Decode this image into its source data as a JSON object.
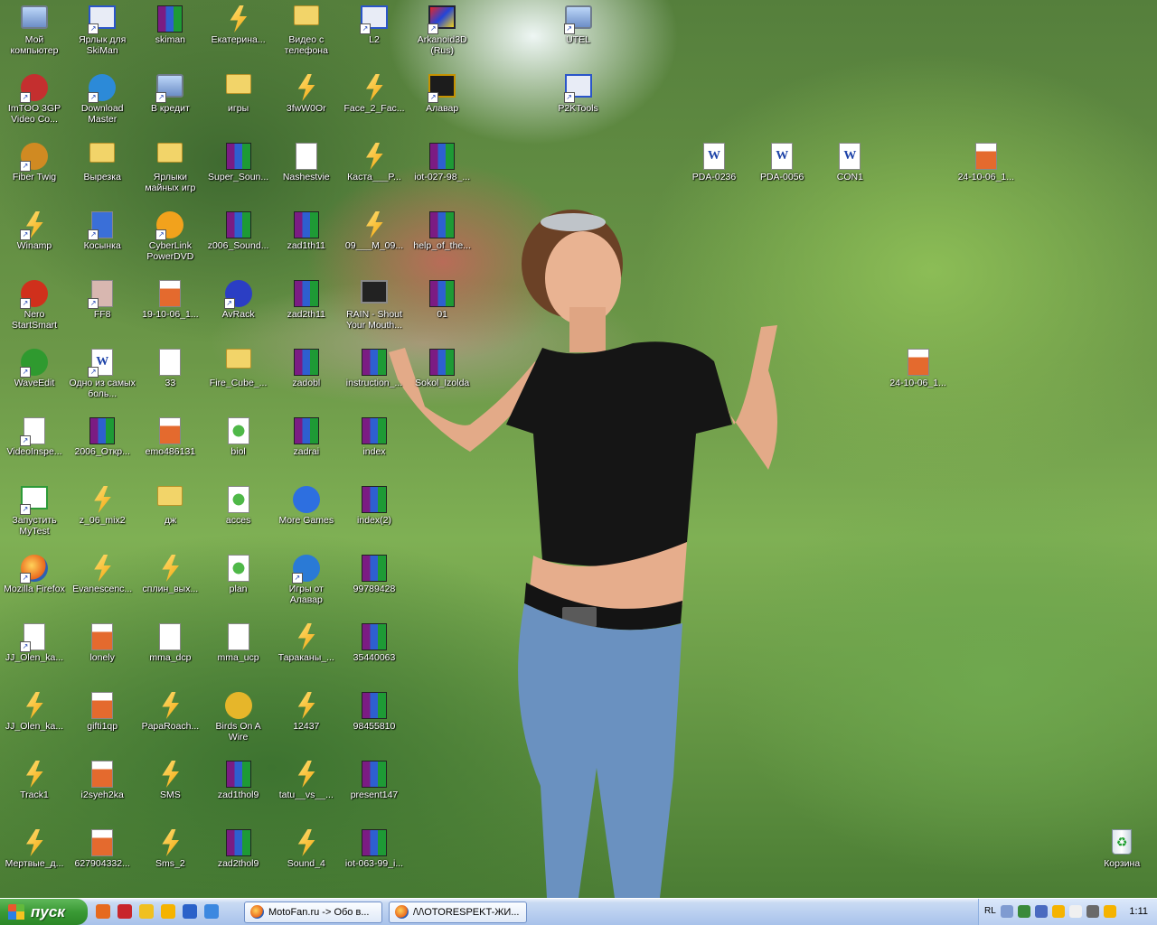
{
  "desktop": {
    "icons": [
      {
        "label": "Мой компьютер",
        "col": 0,
        "row": 0,
        "type": "pc",
        "shortcut": false
      },
      {
        "label": "Ярлык для SkiMan",
        "col": 1,
        "row": 0,
        "type": "app",
        "shortcut": true
      },
      {
        "label": "skiman",
        "col": 2,
        "row": 0,
        "type": "rar",
        "shortcut": false
      },
      {
        "label": "Екатерина...",
        "col": 3,
        "row": 0,
        "type": "winamp",
        "shortcut": false
      },
      {
        "label": "Видео с телефона",
        "col": 4,
        "row": 0,
        "type": "folder",
        "shortcut": false
      },
      {
        "label": "L2",
        "col": 5,
        "row": 0,
        "type": "app",
        "shortcut": true
      },
      {
        "label": "Arkanoid3D (Rus)",
        "col": 6,
        "row": 0,
        "type": "arkanoid",
        "shortcut": true
      },
      {
        "label": "UTEL",
        "col": 8,
        "row": 0,
        "type": "pc",
        "shortcut": true
      },
      {
        "label": "ImTOO 3GP Video Co...",
        "col": 0,
        "row": 1,
        "type": "imtoo",
        "shortcut": true
      },
      {
        "label": "Download Master",
        "col": 1,
        "row": 1,
        "type": "dlm",
        "shortcut": true
      },
      {
        "label": "В кредит",
        "col": 2,
        "row": 1,
        "type": "pc",
        "shortcut": true
      },
      {
        "label": "игры",
        "col": 3,
        "row": 1,
        "type": "folder",
        "shortcut": false
      },
      {
        "label": "3fwW0Or",
        "col": 4,
        "row": 1,
        "type": "winamp",
        "shortcut": false
      },
      {
        "label": "Face_2_Fac...",
        "col": 5,
        "row": 1,
        "type": "winamp",
        "shortcut": false
      },
      {
        "label": "Алавар",
        "col": 6,
        "row": 1,
        "type": "alawar",
        "shortcut": true
      },
      {
        "label": "P2KTools",
        "col": 8,
        "row": 1,
        "type": "app",
        "shortcut": true
      },
      {
        "label": "Fiber Twig",
        "col": 0,
        "row": 2,
        "type": "twig",
        "shortcut": true
      },
      {
        "label": "Вырезка",
        "col": 1,
        "row": 2,
        "type": "folder",
        "shortcut": false
      },
      {
        "label": "Ярлыки майных игр",
        "col": 2,
        "row": 2,
        "type": "folder",
        "shortcut": false
      },
      {
        "label": "Super_Soun...",
        "col": 3,
        "row": 2,
        "type": "rar",
        "shortcut": false
      },
      {
        "label": "Nashestvie",
        "col": 4,
        "row": 2,
        "type": "file",
        "shortcut": false
      },
      {
        "label": "Каста___P...",
        "col": 5,
        "row": 2,
        "type": "winamp",
        "shortcut": false
      },
      {
        "label": "iot-027-98_...",
        "col": 6,
        "row": 2,
        "type": "rar",
        "shortcut": false
      },
      {
        "label": "PDA-0236",
        "col": 10,
        "row": 2,
        "type": "word",
        "shortcut": false
      },
      {
        "label": "PDA-0056",
        "col": 11,
        "row": 2,
        "type": "word",
        "shortcut": false
      },
      {
        "label": "CON1",
        "col": 12,
        "row": 2,
        "type": "word",
        "shortcut": false
      },
      {
        "label": "24-10-06_1...",
        "col": 14,
        "row": 2,
        "type": "media",
        "shortcut": false
      },
      {
        "label": "Winamp",
        "col": 0,
        "row": 3,
        "type": "winamp",
        "shortcut": true
      },
      {
        "label": "Косынка",
        "col": 1,
        "row": 3,
        "type": "cards",
        "shortcut": true
      },
      {
        "label": "CyberLink PowerDVD",
        "col": 2,
        "row": 3,
        "type": "dvd",
        "shortcut": true
      },
      {
        "label": "z006_Sound...",
        "col": 3,
        "row": 3,
        "type": "rar",
        "shortcut": false
      },
      {
        "label": "zad1th11",
        "col": 4,
        "row": 3,
        "type": "rar",
        "shortcut": false
      },
      {
        "label": "09___M_09...",
        "col": 5,
        "row": 3,
        "type": "winamp",
        "shortcut": false
      },
      {
        "label": "help_of_the...",
        "col": 6,
        "row": 3,
        "type": "rar",
        "shortcut": false
      },
      {
        "label": "Nero StartSmart",
        "col": 0,
        "row": 4,
        "type": "nero",
        "shortcut": true
      },
      {
        "label": "FF8",
        "col": 1,
        "row": 4,
        "type": "ff8",
        "shortcut": true
      },
      {
        "label": "19-10-06_1...",
        "col": 2,
        "row": 4,
        "type": "media",
        "shortcut": false
      },
      {
        "label": "AvRack",
        "col": 3,
        "row": 4,
        "type": "avrack",
        "shortcut": true
      },
      {
        "label": "zad2th11",
        "col": 4,
        "row": 4,
        "type": "rar",
        "shortcut": false
      },
      {
        "label": "RAIN - Shout Your Mouth...",
        "col": 5,
        "row": 4,
        "type": "clapper",
        "shortcut": false
      },
      {
        "label": "01",
        "col": 6,
        "row": 4,
        "type": "rar",
        "shortcut": false
      },
      {
        "label": "WaveEdit",
        "col": 0,
        "row": 5,
        "type": "wave",
        "shortcut": true
      },
      {
        "label": "Одно из самых боль...",
        "col": 1,
        "row": 5,
        "type": "word",
        "shortcut": true
      },
      {
        "label": "33",
        "col": 2,
        "row": 5,
        "type": "file",
        "shortcut": false
      },
      {
        "label": "Fire_Cube_...",
        "col": 3,
        "row": 5,
        "type": "folder",
        "shortcut": false
      },
      {
        "label": "zadobl",
        "col": 4,
        "row": 5,
        "type": "rar",
        "shortcut": false
      },
      {
        "label": "instruction_...",
        "col": 5,
        "row": 5,
        "type": "rar",
        "shortcut": false
      },
      {
        "label": "Sokol_Izolda",
        "col": 6,
        "row": 5,
        "type": "rar",
        "shortcut": false
      },
      {
        "label": "24-10-06_1...",
        "col": 13,
        "row": 5,
        "type": "media",
        "shortcut": false
      },
      {
        "label": "VideoInspe...",
        "col": 0,
        "row": 6,
        "type": "file",
        "shortcut": true
      },
      {
        "label": "2006_Откр...",
        "col": 1,
        "row": 6,
        "type": "rar",
        "shortcut": false
      },
      {
        "label": "emo486131",
        "col": 2,
        "row": 6,
        "type": "media",
        "shortcut": false
      },
      {
        "label": "biol",
        "col": 3,
        "row": 6,
        "type": "globe",
        "shortcut": false
      },
      {
        "label": "zadrai",
        "col": 4,
        "row": 6,
        "type": "rar",
        "shortcut": false
      },
      {
        "label": "index",
        "col": 5,
        "row": 6,
        "type": "rar",
        "shortcut": false
      },
      {
        "label": "Запустить MyTest",
        "col": 0,
        "row": 7,
        "type": "mytest",
        "shortcut": true
      },
      {
        "label": "z_06_mix2",
        "col": 1,
        "row": 7,
        "type": "winamp",
        "shortcut": false
      },
      {
        "label": "дж",
        "col": 2,
        "row": 7,
        "type": "folder",
        "shortcut": false
      },
      {
        "label": "acces",
        "col": 3,
        "row": 7,
        "type": "globe",
        "shortcut": false
      },
      {
        "label": "More Games",
        "col": 4,
        "row": 7,
        "type": "moregames",
        "shortcut": false
      },
      {
        "label": "index(2)",
        "col": 5,
        "row": 7,
        "type": "rar",
        "shortcut": false
      },
      {
        "label": "Mozilla Firefox",
        "col": 0,
        "row": 8,
        "type": "firefox",
        "shortcut": true
      },
      {
        "label": "Evanescenc...",
        "col": 1,
        "row": 8,
        "type": "winamp",
        "shortcut": false
      },
      {
        "label": "сплин_вых...",
        "col": 2,
        "row": 8,
        "type": "winamp",
        "shortcut": false
      },
      {
        "label": "plan",
        "col": 3,
        "row": 8,
        "type": "globe",
        "shortcut": false
      },
      {
        "label": "Игры от Алавар",
        "col": 4,
        "row": 8,
        "type": "alawar2",
        "shortcut": true
      },
      {
        "label": "99789428",
        "col": 5,
        "row": 8,
        "type": "rar",
        "shortcut": false
      },
      {
        "label": "JJ_Olen_ka...",
        "col": 0,
        "row": 9,
        "type": "file",
        "shortcut": true
      },
      {
        "label": "lonely",
        "col": 1,
        "row": 9,
        "type": "media",
        "shortcut": false
      },
      {
        "label": "mma_dcp",
        "col": 2,
        "row": 9,
        "type": "file",
        "shortcut": false
      },
      {
        "label": "mma_ucp",
        "col": 3,
        "row": 9,
        "type": "file",
        "shortcut": false
      },
      {
        "label": "Тараканы_...",
        "col": 4,
        "row": 9,
        "type": "winamp",
        "shortcut": false
      },
      {
        "label": "35440063",
        "col": 5,
        "row": 9,
        "type": "rar",
        "shortcut": false
      },
      {
        "label": "JJ_Olen_ka...",
        "col": 0,
        "row": 10,
        "type": "winamp",
        "shortcut": false
      },
      {
        "label": "gifti1qp",
        "col": 1,
        "row": 10,
        "type": "media",
        "shortcut": false
      },
      {
        "label": "PapaRoach...",
        "col": 2,
        "row": 10,
        "type": "winamp",
        "shortcut": false
      },
      {
        "label": "Birds On A Wire",
        "col": 3,
        "row": 10,
        "type": "bird",
        "shortcut": false
      },
      {
        "label": "12437",
        "col": 4,
        "row": 10,
        "type": "winamp",
        "shortcut": false
      },
      {
        "label": "98455810",
        "col": 5,
        "row": 10,
        "type": "rar",
        "shortcut": false
      },
      {
        "label": "Track1",
        "col": 0,
        "row": 11,
        "type": "winamp",
        "shortcut": false
      },
      {
        "label": "i2syeh2ka",
        "col": 1,
        "row": 11,
        "type": "media",
        "shortcut": false
      },
      {
        "label": "SMS",
        "col": 2,
        "row": 11,
        "type": "winamp",
        "shortcut": false
      },
      {
        "label": "zad1thol9",
        "col": 3,
        "row": 11,
        "type": "rar",
        "shortcut": false
      },
      {
        "label": "tatu__vs__...",
        "col": 4,
        "row": 11,
        "type": "winamp",
        "shortcut": false
      },
      {
        "label": "present147",
        "col": 5,
        "row": 11,
        "type": "rar",
        "shortcut": false
      },
      {
        "label": "Мертвые_д...",
        "col": 0,
        "row": 12,
        "type": "winamp",
        "shortcut": false
      },
      {
        "label": "627904332...",
        "col": 1,
        "row": 12,
        "type": "media",
        "shortcut": false
      },
      {
        "label": "Sms_2",
        "col": 2,
        "row": 12,
        "type": "winamp",
        "shortcut": false
      },
      {
        "label": "zad2thol9",
        "col": 3,
        "row": 12,
        "type": "rar",
        "shortcut": false
      },
      {
        "label": "Sound_4",
        "col": 4,
        "row": 12,
        "type": "winamp",
        "shortcut": false
      },
      {
        "label": "iot-063-99_i...",
        "col": 5,
        "row": 12,
        "type": "rar",
        "shortcut": false
      },
      {
        "label": "Корзина",
        "col": 16,
        "row": 12,
        "type": "bin",
        "shortcut": false
      }
    ]
  },
  "taskbar": {
    "start_label": "пуск",
    "quick_launch": [
      {
        "name": "firefox-quicklaunch-icon",
        "color": "#e66a1f"
      },
      {
        "name": "opera-quicklaunch-icon",
        "color": "#c8252b"
      },
      {
        "name": "notepad-quicklaunch-icon",
        "color": "#f0c020"
      },
      {
        "name": "winamp-quicklaunch-icon",
        "color": "#f5b300"
      },
      {
        "name": "media-player-quicklaunch-icon",
        "color": "#2a61c9"
      },
      {
        "name": "ie-quicklaunch-icon",
        "color": "#3c88e0"
      }
    ],
    "tasks": [
      {
        "label": "MotoFan.ru -> Обо в..."
      },
      {
        "label": "/\\/\\OTORESPEKT-ЖИ..."
      }
    ],
    "tray": {
      "language": "RL",
      "clock": "1:11",
      "icons": [
        {
          "name": "tray-arrow-icon",
          "color": "#7f9bd1"
        },
        {
          "name": "tray-network-icon",
          "color": "#3a8a3a"
        },
        {
          "name": "tray-monitor-icon",
          "color": "#4a6ac0"
        },
        {
          "name": "tray-winamp-icon",
          "color": "#f5b300"
        },
        {
          "name": "tray-mail-icon",
          "color": "#f0f0f0"
        },
        {
          "name": "tray-speaker-icon",
          "color": "#6a6a6a"
        },
        {
          "name": "tray-agent-icon",
          "color": "#f5b300"
        }
      ]
    }
  }
}
